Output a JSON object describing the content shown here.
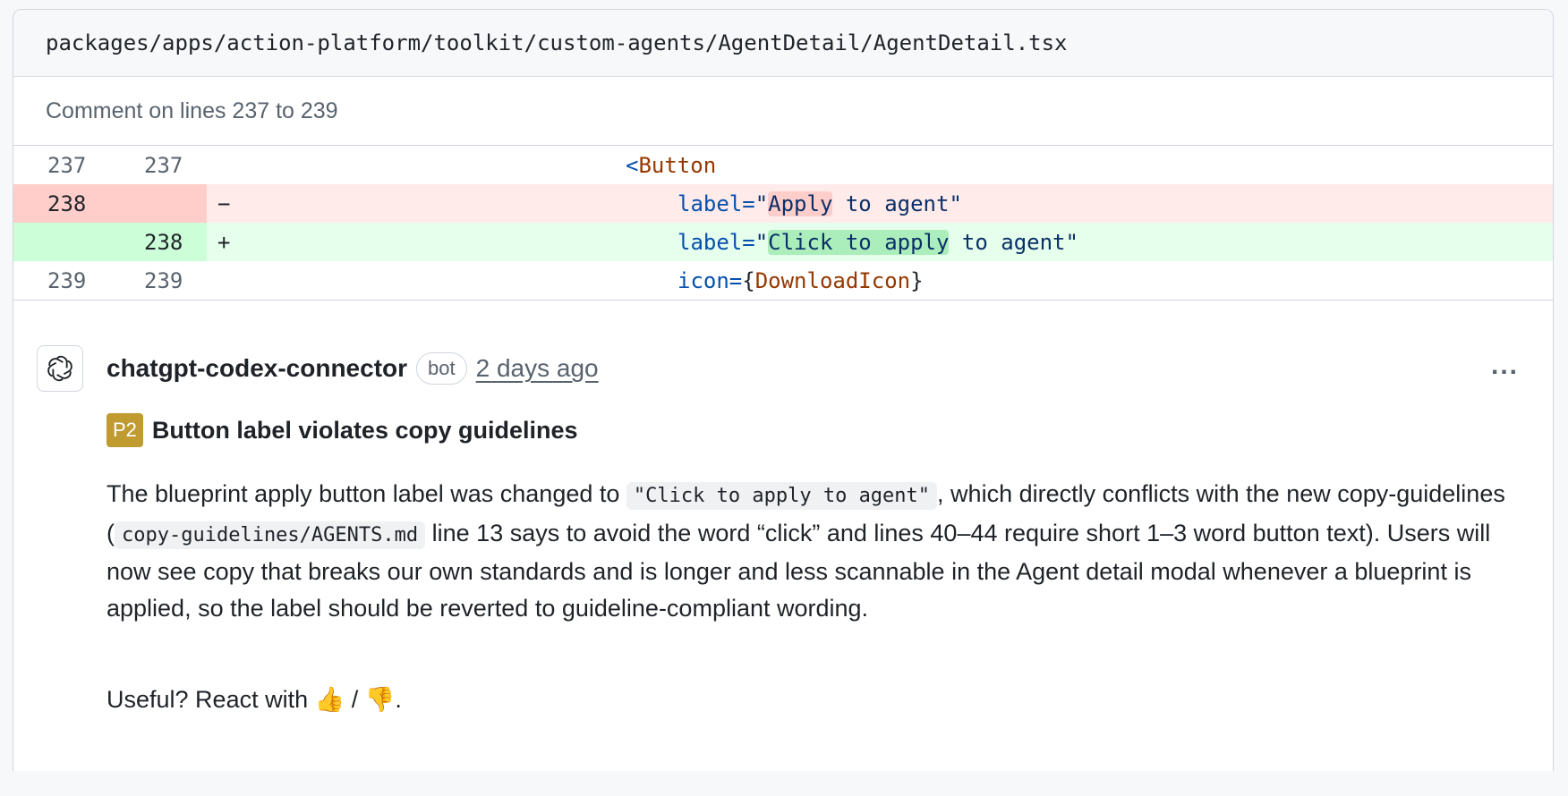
{
  "file": {
    "path": "packages/apps/action-platform/toolkit/custom-agents/AgentDetail/AgentDetail.tsx"
  },
  "comment_range": "Comment on lines 237 to 239",
  "diff": {
    "rows": [
      {
        "old": "237",
        "new": "237",
        "marker": "",
        "type": "context",
        "parts": [
          {
            "t": "<",
            "c": "punc"
          },
          {
            "t": "Button",
            "c": "tag"
          }
        ]
      },
      {
        "old": "238",
        "new": "",
        "marker": "−",
        "type": "del",
        "parts": [
          {
            "t": "label=",
            "c": "attr"
          },
          {
            "t": "\"",
            "c": "str"
          },
          {
            "t": "Apply",
            "c": "hl-del"
          },
          {
            "t": " to agent\"",
            "c": "str"
          }
        ]
      },
      {
        "old": "",
        "new": "238",
        "marker": "+",
        "type": "add",
        "parts": [
          {
            "t": "label=",
            "c": "attr"
          },
          {
            "t": "\"",
            "c": "str"
          },
          {
            "t": "Click to apply",
            "c": "hl-add"
          },
          {
            "t": " to agent\"",
            "c": "str"
          }
        ]
      },
      {
        "old": "239",
        "new": "239",
        "marker": "",
        "type": "context",
        "parts": [
          {
            "t": "icon=",
            "c": "attr"
          },
          {
            "t": "{",
            "c": "plain"
          },
          {
            "t": "DownloadIcon",
            "c": "tag"
          },
          {
            "t": "}",
            "c": "plain"
          }
        ]
      }
    ]
  },
  "comment": {
    "author": "chatgpt-codex-connector",
    "badge": "bot",
    "time": "2 days ago",
    "more": "...",
    "priority": "P2",
    "title": "Button label violates copy guidelines",
    "body_1": "The blueprint apply button label was changed to ",
    "code_1": "\"Click to apply to agent\"",
    "body_2": ", which directly conflicts with the new copy-guidelines (",
    "code_2": "copy-guidelines/AGENTS.md",
    "body_3": " line 13 says to avoid the word “click” and lines 40–44 require short 1–3 word button text). Users will now see copy that breaks our own standards and is longer and less scannable in the Agent detail modal whenever a blueprint is applied, so the label should be reverted to guideline-compliant wording.",
    "useful_prefix": "Useful? React with ",
    "thumbs_up": "👍",
    "separator": " / ",
    "thumbs_down": "👎",
    "useful_suffix": "."
  },
  "colors": {
    "deleted_bg": "#ffebe9",
    "added_bg": "#e6ffec",
    "priority_badge": "#bf9b30"
  },
  "icons": {
    "avatar": "openai-logo-icon",
    "more": "kebab-menu-icon"
  }
}
